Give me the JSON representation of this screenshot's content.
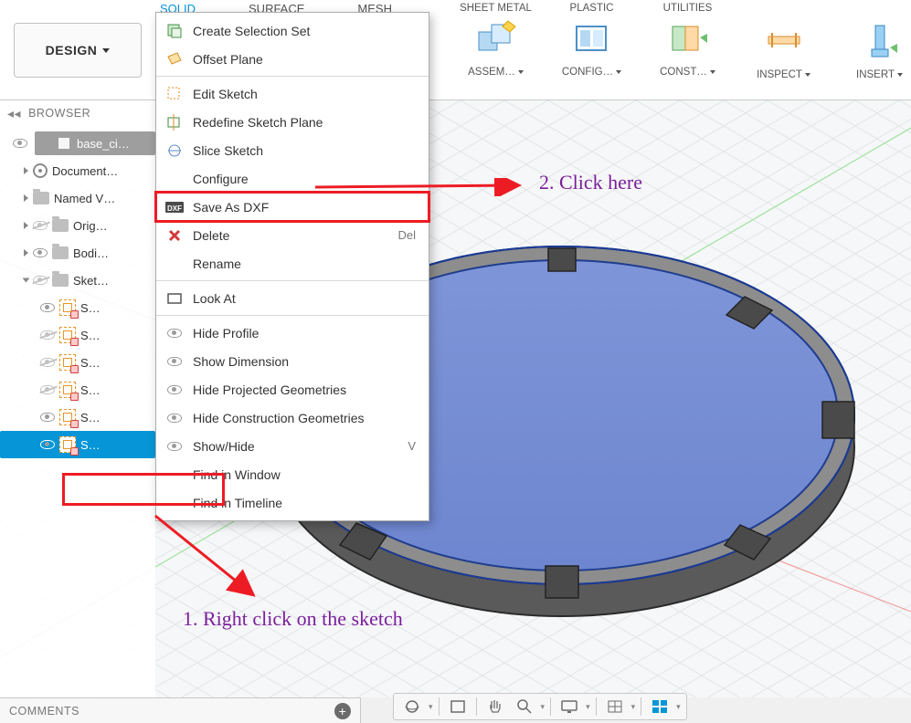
{
  "design_button": "DESIGN",
  "ribbon_tabs": {
    "solid": "SOLID",
    "surface": "SURFACE",
    "mesh": "MESH"
  },
  "ribbon_tools": {
    "sheet_metal": "SHEET METAL",
    "plastic": "PLASTIC",
    "utilities": "UTILITIES",
    "assemble": "ASSEM…",
    "configure": "CONFIG…",
    "construct": "CONST…",
    "inspect": "INSPECT",
    "insert": "INSERT"
  },
  "browser": {
    "title": "BROWSER",
    "root": "base_ci…",
    "document_settings": "Document…",
    "named_views": "Named V…",
    "origin": "Orig…",
    "bodies": "Bodi…",
    "sketches": "Sket…",
    "sketch_item_short": "S…"
  },
  "context_menu": {
    "create_selection_set": "Create Selection Set",
    "offset_plane": "Offset Plane",
    "edit_sketch": "Edit Sketch",
    "redefine_sketch_plane": "Redefine Sketch Plane",
    "slice_sketch": "Slice Sketch",
    "configure": "Configure",
    "save_as_dxf": "Save As DXF",
    "delete": "Delete",
    "delete_shortcut": "Del",
    "rename": "Rename",
    "look_at": "Look At",
    "hide_profile": "Hide Profile",
    "show_dimension": "Show Dimension",
    "hide_projected_geometries": "Hide Projected Geometries",
    "hide_construction_geometries": "Hide Construction Geometries",
    "show_hide": "Show/Hide",
    "show_hide_shortcut": "V",
    "find_in_window": "Find in Window",
    "find_in_timeline": "Find in Timeline"
  },
  "annotations": {
    "step1": "1. Right click on the sketch",
    "step2": "2. Click here"
  },
  "comments": "COMMENTS"
}
